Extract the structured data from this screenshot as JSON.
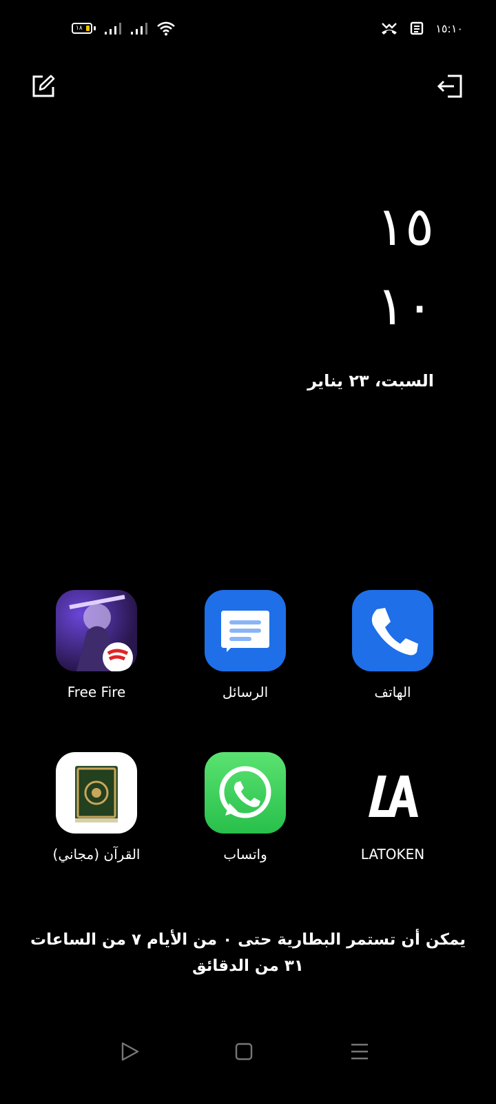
{
  "status_bar": {
    "battery_level": "١٨",
    "time": "١٥:١٠",
    "colors": {
      "battery_low": "#f0c400"
    },
    "icons": [
      "signal-icon",
      "signal-icon",
      "wifi-icon",
      "missed-call-icon",
      "notification-icon"
    ]
  },
  "clock": {
    "hour": "١٥",
    "minute": "١٠",
    "date": "السبت، ٢٣ يناير"
  },
  "apps": [
    {
      "label": "Free Fire",
      "icon": "free-fire-icon"
    },
    {
      "label": "الرسائل",
      "icon": "messages-icon"
    },
    {
      "label": "الهاتف",
      "icon": "phone-icon"
    },
    {
      "label": "القرآن (مجاني)",
      "icon": "quran-icon"
    },
    {
      "label": "واتساب",
      "icon": "whatsapp-icon"
    },
    {
      "label": "LATOKEN",
      "icon": "latoken-icon"
    }
  ],
  "battery_message": "يمكن أن تستمر البطارية حتى ٠ من الأيام ٧ من الساعات ٣١ من الدقائق",
  "colors": {
    "background": "#000000",
    "phone_blue": "#1e6fe8",
    "whatsapp_green": "#27c04a"
  }
}
